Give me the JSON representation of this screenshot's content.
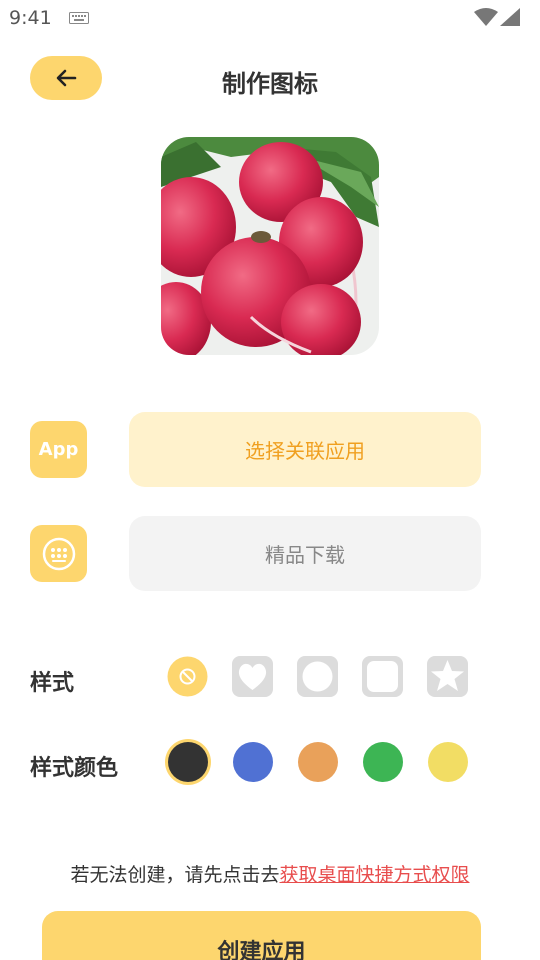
{
  "status_bar": {
    "time": "9:41",
    "keyboard_icon": "keyboard-icon",
    "wifi_icon": "wifi-icon",
    "signal_icon": "signal-icon"
  },
  "header": {
    "title": "制作图标",
    "back_icon": "arrow-left-icon"
  },
  "preview": {
    "icon": "radish-photo"
  },
  "app_row": {
    "icon_text": "App",
    "button_label": "选择关联应用"
  },
  "download_row": {
    "icon": "grid-dots-icon",
    "button_label": "精品下载"
  },
  "style": {
    "label": "样式",
    "options": [
      "none",
      "heart",
      "circle",
      "rounded-square",
      "star"
    ],
    "selected": "none"
  },
  "style_color": {
    "label": "样式颜色",
    "colors": [
      "#333333",
      "#5071d3",
      "#e9a15a",
      "#3db554",
      "#f2dd64"
    ],
    "selected": "#333333"
  },
  "hint": {
    "text": "若无法创建，请先点击去",
    "link": "获取桌面快捷方式权限"
  },
  "create_button": {
    "label": "创建应用"
  },
  "theme": {
    "accent": "#fdd66e",
    "accent_light": "#fff2cc",
    "link_color": "#e84d4d"
  }
}
